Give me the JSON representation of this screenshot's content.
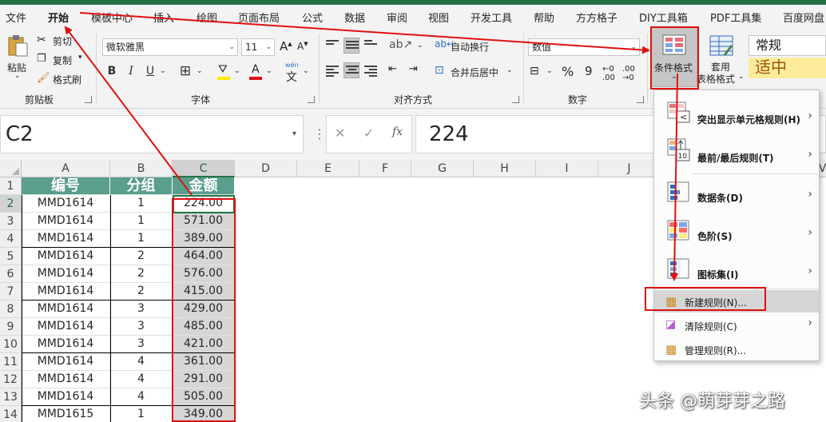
{
  "menu": {
    "tabs": [
      "文件",
      "开始",
      "模板中心",
      "插入",
      "绘图",
      "页面布局",
      "公式",
      "数据",
      "审阅",
      "视图",
      "开发工具",
      "帮助",
      "方方格子",
      "DIY工具箱",
      "PDF工具集",
      "百度网盘"
    ],
    "active": "开始"
  },
  "ribbon": {
    "clipboard": {
      "paste": "粘贴",
      "cut": "剪切",
      "copy": "复制",
      "format_painter": "格式刷",
      "group": "剪贴板"
    },
    "font": {
      "name": "微软雅黑",
      "size": "11",
      "bold": "B",
      "italic": "I",
      "underline": "U",
      "group": "字体",
      "wen": "wén"
    },
    "alignment": {
      "wrap": "自动换行",
      "merge": "合并后居中",
      "group": "对齐方式"
    },
    "number": {
      "format": "数值",
      "percent": "%",
      "comma": "9",
      "group": "数字"
    },
    "styles": {
      "conditional": "条件格式",
      "table_format_1": "套用",
      "table_format_2": "表格格式",
      "normal": "常规",
      "neutral": "适中"
    }
  },
  "formula_bar": {
    "name_box": "C2",
    "cancel": "✕",
    "confirm": "✓",
    "fx": "fx",
    "value": "224"
  },
  "columns": [
    "A",
    "B",
    "C",
    "D",
    "E",
    "F",
    "G",
    "H",
    "I",
    "J",
    "V"
  ],
  "table": {
    "headers": [
      "编号",
      "分组",
      "金额"
    ],
    "rows": [
      {
        "id": "MMD1614",
        "group": "1",
        "amount": "224.00"
      },
      {
        "id": "MMD1614",
        "group": "1",
        "amount": "571.00"
      },
      {
        "id": "MMD1614",
        "group": "1",
        "amount": "389.00"
      },
      {
        "id": "MMD1614",
        "group": "2",
        "amount": "464.00"
      },
      {
        "id": "MMD1614",
        "group": "2",
        "amount": "576.00"
      },
      {
        "id": "MMD1614",
        "group": "2",
        "amount": "415.00"
      },
      {
        "id": "MMD1614",
        "group": "3",
        "amount": "429.00"
      },
      {
        "id": "MMD1614",
        "group": "3",
        "amount": "485.00"
      },
      {
        "id": "MMD1614",
        "group": "3",
        "amount": "421.00"
      },
      {
        "id": "MMD1614",
        "group": "4",
        "amount": "361.00"
      },
      {
        "id": "MMD1614",
        "group": "4",
        "amount": "291.00"
      },
      {
        "id": "MMD1614",
        "group": "4",
        "amount": "505.00"
      },
      {
        "id": "MMD1615",
        "group": "1",
        "amount": "349.00"
      }
    ],
    "row_numbers": [
      "1",
      "2",
      "3",
      "4",
      "5",
      "6",
      "7",
      "8",
      "9",
      "10",
      "11",
      "12",
      "13",
      "14"
    ]
  },
  "cf_menu": {
    "items": [
      {
        "label": "突出显示单元格规则(H)",
        "sub": true
      },
      {
        "label": "最前/最后规则(T)",
        "sub": true
      },
      {
        "label": "数据条(D)",
        "sub": true
      },
      {
        "label": "色阶(S)",
        "sub": true
      },
      {
        "label": "图标集(I)",
        "sub": true
      },
      {
        "label": "新建规则(N)...",
        "sub": false
      },
      {
        "label": "清除规则(C)",
        "sub": true
      },
      {
        "label": "管理规则(R)...",
        "sub": false
      }
    ]
  },
  "watermark": "头条 @萌芽芽之路",
  "colors": {
    "excel_green": "#217346",
    "header_fill": "#5a9e8e",
    "annotation_red": "#e01010",
    "neutral_fill": "#ffeb9c",
    "neutral_text": "#9c5700"
  }
}
